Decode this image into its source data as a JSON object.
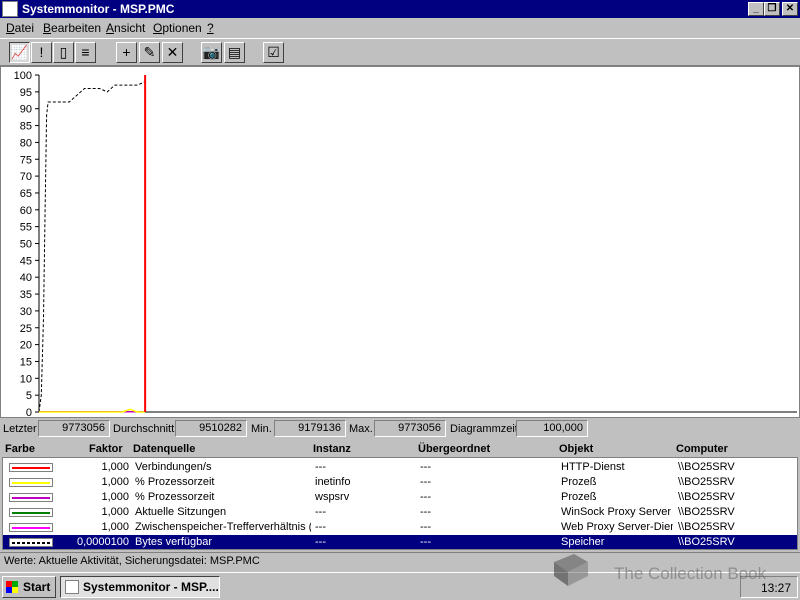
{
  "window": {
    "title": "Systemmonitor - MSP.PMC"
  },
  "caption_buttons": {
    "minimize": "_",
    "restore": "❐",
    "close": "✕"
  },
  "menu": [
    {
      "label": "Datei",
      "accel": "D",
      "rest": "atei"
    },
    {
      "label": "Bearbeiten",
      "accel": "B",
      "rest": "earbeiten"
    },
    {
      "label": "Ansicht",
      "accel": "A",
      "rest": "nsicht"
    },
    {
      "label": "Optionen",
      "accel": "O",
      "rest": "ptionen"
    },
    {
      "label": "?",
      "accel": "?",
      "rest": ""
    }
  ],
  "toolbar": [
    {
      "icon": "chart-view-icon",
      "glyph": "📈",
      "pressed": true
    },
    {
      "icon": "alert-view-icon",
      "glyph": "!",
      "pressed": false
    },
    {
      "icon": "log-view-icon",
      "glyph": "▯",
      "pressed": false
    },
    {
      "icon": "report-view-icon",
      "glyph": "≡",
      "pressed": false
    },
    {
      "icon": "add-counter-icon",
      "glyph": "+",
      "pressed": false
    },
    {
      "icon": "edit-counter-icon",
      "glyph": "✎",
      "pressed": false
    },
    {
      "icon": "delete-counter-icon",
      "glyph": "✕",
      "pressed": false
    },
    {
      "icon": "snapshot-icon",
      "glyph": "📷",
      "pressed": false
    },
    {
      "icon": "export-icon",
      "glyph": "▤",
      "pressed": false
    },
    {
      "icon": "options-icon",
      "glyph": "☑",
      "pressed": false
    }
  ],
  "stats": {
    "last_label": "Letzter",
    "last_value": "9773056",
    "avg_label": "Durchschnitt",
    "avg_value": "9510282",
    "min_label": "Min.",
    "min_value": "9179136",
    "max_label": "Max.",
    "max_value": "9773056",
    "time_label": "Diagrammzeit",
    "time_value": "100,000"
  },
  "legend_headers": {
    "color": "Farbe",
    "factor": "Faktor",
    "counter": "Datenquelle",
    "instance": "Instanz",
    "parent": "Übergeordnet",
    "object": "Objekt",
    "computer": "Computer"
  },
  "legend_rows": [
    {
      "color": "#ff0000",
      "factor": "1,000",
      "counter": "Verbindungen/s",
      "instance": "---",
      "parent": "---",
      "object": "HTTP-Dienst",
      "computer": "\\\\BO25SRV",
      "selected": false
    },
    {
      "color": "#ffff00",
      "factor": "1,000",
      "counter": "% Prozessorzeit",
      "instance": "inetinfo",
      "parent": "---",
      "object": "Prozeß",
      "computer": "\\\\BO25SRV",
      "selected": false
    },
    {
      "color": "#c000c0",
      "factor": "1,000",
      "counter": "% Prozessorzeit",
      "instance": "wspsrv",
      "parent": "---",
      "object": "Prozeß",
      "computer": "\\\\BO25SRV",
      "selected": false
    },
    {
      "color": "#008000",
      "factor": "1,000",
      "counter": "Aktuelle Sitzungen",
      "instance": "---",
      "parent": "---",
      "object": "WinSock Proxy Server",
      "computer": "\\\\BO25SRV",
      "selected": false
    },
    {
      "color": "#ff00ff",
      "factor": "1,000",
      "counter": "Zwischenspeicher-Trefferverhältnis (%)",
      "instance": "---",
      "parent": "---",
      "object": "Web Proxy Server-Dienst",
      "computer": "\\\\BO25SRV",
      "selected": false
    },
    {
      "color": "#000000",
      "factor": "0,0000100",
      "counter": "Bytes verfügbar",
      "instance": "---",
      "parent": "---",
      "object": "Speicher",
      "computer": "\\\\BO25SRV",
      "selected": true
    }
  ],
  "status": {
    "text": "Werte: Aktuelle Aktivität, Sicherungsdatei: MSP.PMC"
  },
  "taskbar": {
    "start_label": "Start",
    "task_label": "Systemmonitor - MSP....",
    "clock": "13:27"
  },
  "watermark": {
    "text": "The Collection Book"
  },
  "chart_data": {
    "type": "line",
    "ylim": [
      0,
      100
    ],
    "yticks": [
      "0",
      "5",
      "10",
      "15",
      "20",
      "25",
      "30",
      "35",
      "40",
      "45",
      "50",
      "55",
      "60",
      "65",
      "70",
      "75",
      "80",
      "85",
      "90",
      "95",
      "100"
    ],
    "xlim": [
      0,
      100
    ],
    "current_position": 14,
    "grid": false,
    "series": [
      {
        "color": "#000000",
        "dashed": true,
        "x": [
          0,
          0.3,
          0.6,
          0.8,
          1.0,
          1.2,
          1.5,
          2,
          3,
          4,
          5,
          6,
          7,
          8,
          9,
          10,
          11,
          12,
          13,
          14
        ],
        "y": [
          0,
          5,
          28,
          60,
          88,
          92,
          92,
          92,
          92,
          92,
          94,
          96,
          96,
          96,
          95,
          97,
          97,
          97,
          97,
          98
        ]
      },
      {
        "color": "#c000c0",
        "dashed": false,
        "x": [
          0,
          14
        ],
        "y": [
          0.1,
          0.1
        ]
      },
      {
        "color": "#ffff00",
        "dashed": false,
        "x": [
          0,
          11,
          12,
          13,
          14
        ],
        "y": [
          0,
          0,
          0.8,
          0,
          0
        ]
      }
    ]
  }
}
